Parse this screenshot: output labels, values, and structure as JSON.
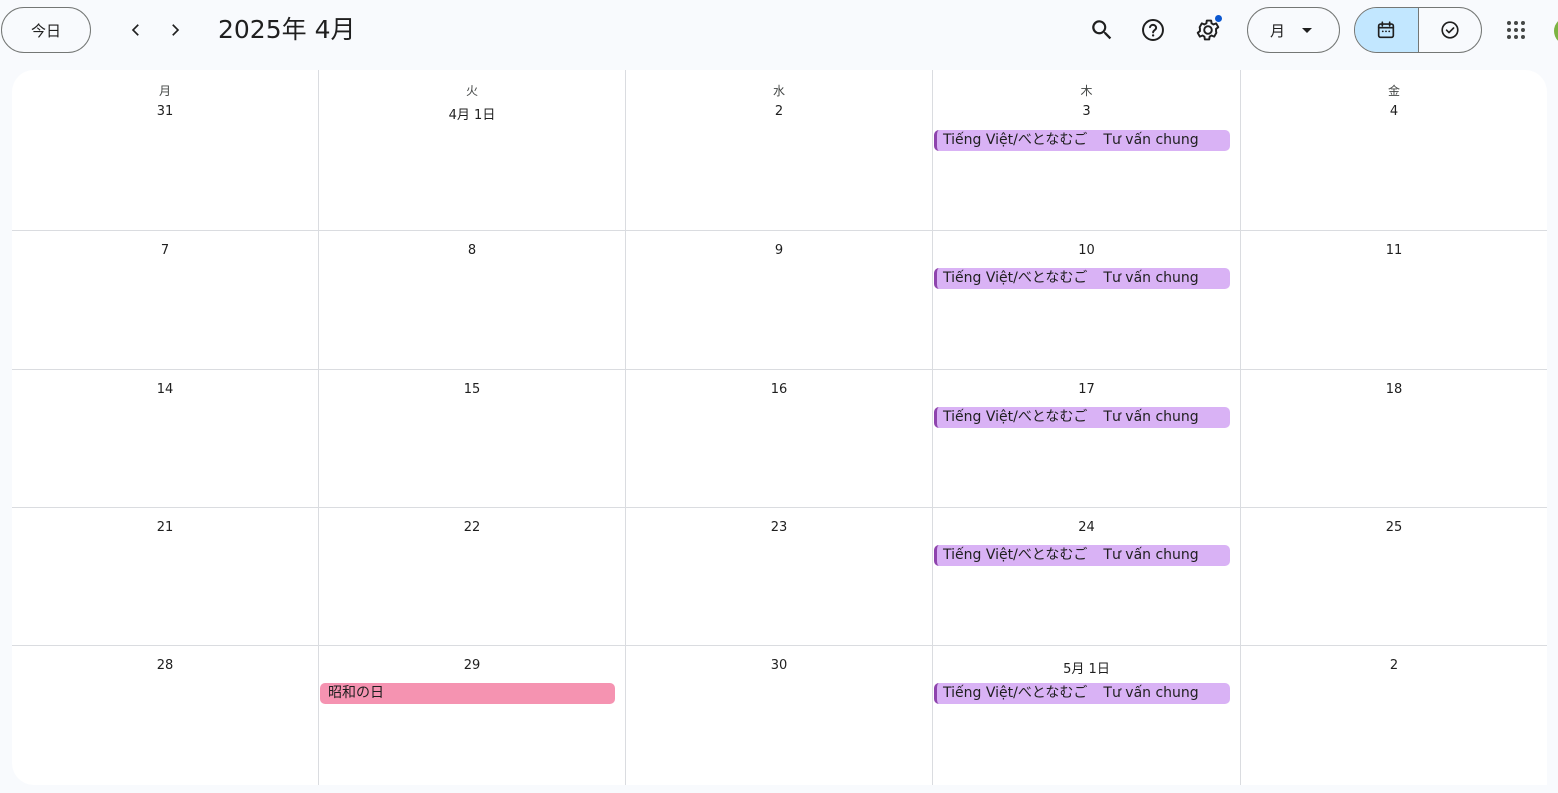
{
  "header": {
    "today_label": "今日",
    "month_title": "2025年 4月",
    "view_label": "月",
    "icons": {
      "prev": "chevron-left-icon",
      "next": "chevron-right-icon",
      "search": "search-icon",
      "help": "help-icon",
      "settings": "gear-icon",
      "calendar_view": "calendar-icon",
      "tasks_view": "task-check-icon",
      "apps": "apps-grid-icon"
    },
    "accent_color": "#c2e7ff",
    "notification_dot_color": "#0b57d0"
  },
  "weekdays": [
    "月",
    "火",
    "水",
    "木",
    "金"
  ],
  "weeks": [
    [
      "31",
      "4月 1日",
      "2",
      "3",
      "4"
    ],
    [
      "7",
      "8",
      "9",
      "10",
      "11"
    ],
    [
      "14",
      "15",
      "16",
      "17",
      "18"
    ],
    [
      "21",
      "22",
      "23",
      "24",
      "25"
    ],
    [
      "28",
      "29",
      "30",
      "5月 1日",
      "2"
    ]
  ],
  "events": [
    {
      "week": 0,
      "day": 3,
      "title": "Tiếng Việt/べとなむご",
      "subtitle": "Tư vấn chung",
      "color": "#d9b2f5"
    },
    {
      "week": 1,
      "day": 3,
      "title": "Tiếng Việt/べとなむご",
      "subtitle": "Tư vấn chung",
      "color": "#d9b2f5"
    },
    {
      "week": 2,
      "day": 3,
      "title": "Tiếng Việt/べとなむご",
      "subtitle": "Tư vấn chung",
      "color": "#d9b2f5"
    },
    {
      "week": 3,
      "day": 3,
      "title": "Tiếng Việt/べとなむご",
      "subtitle": "Tư vấn chung",
      "color": "#d9b2f5"
    },
    {
      "week": 4,
      "day": 3,
      "title": "Tiếng Việt/べとなむご",
      "subtitle": "Tư vấn chung",
      "color": "#d9b2f5"
    },
    {
      "week": 4,
      "day": 1,
      "title": "昭和の日",
      "subtitle": "",
      "color": "#f593b1"
    }
  ]
}
